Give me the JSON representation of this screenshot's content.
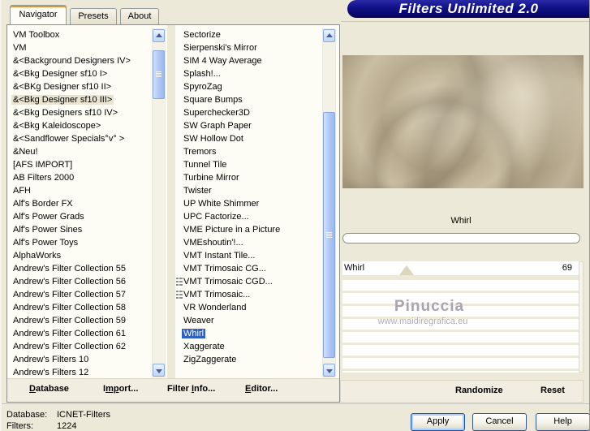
{
  "window": {
    "banner_title": "Filters Unlimited 2.0"
  },
  "tabs": {
    "navigator": "Navigator",
    "presets": "Presets",
    "about": "About"
  },
  "category_list": {
    "selected_index": 5,
    "items": [
      "VM Toolbox",
      "VM",
      "&<Background Designers IV>",
      "&<Bkg Designer sf10 I>",
      "&<BKg Designer sf10 II>",
      "&<Bkg Designer sf10 III>",
      "&<Bkg Designers sf10 IV>",
      "&<Bkg Kaleidoscope>",
      "&<Sandflower Specials°v° >",
      "&Neu!",
      "[AFS IMPORT]",
      "AB Filters 2000",
      "AFH",
      "Alf's Border FX",
      "Alf's Power Grads",
      "Alf's Power Sines",
      "Alf's Power Toys",
      "AlphaWorks",
      "Andrew's Filter Collection 55",
      "Andrew's Filter Collection 56",
      "Andrew's Filter Collection 57",
      "Andrew's Filter Collection 58",
      "Andrew's Filter Collection 59",
      "Andrew's Filter Collection 61",
      "Andrew's Filter Collection 62",
      "Andrew's Filters 10",
      "Andrew's Filters 12"
    ]
  },
  "filter_list": {
    "selected_index": 23,
    "icon_indices": [
      19,
      20
    ],
    "items": [
      "Sectorize",
      "Sierpenski's Mirror",
      "SIM 4 Way Average",
      "Splash!...",
      "SpyroZag",
      "Square Bumps",
      "Superchecker3D",
      "SW Graph Paper",
      "SW Hollow Dot",
      "Tremors",
      "Tunnel Tile",
      "Turbine Mirror",
      "Twister",
      "UP White Shimmer",
      "UPC Factorize...",
      "VME Picture in a Picture",
      "VMEshoutin'!...",
      "VMT Instant Tile...",
      "VMT Trimosaic CG...",
      "VMT Trimosaic CGD...",
      "VMT Trimosaic...",
      "VR Wonderland",
      "Weaver",
      "Whirl",
      "Xaggerate",
      "ZigZaggerate"
    ]
  },
  "preview": {
    "filter_name": "Whirl"
  },
  "slider": {
    "label": "Whirl",
    "value": "69"
  },
  "watermark": {
    "name": "Pinuccia",
    "url": "www.maidiregrafica.eu"
  },
  "actions": {
    "database": {
      "pre": "",
      "u": "D",
      "post": "atabase"
    },
    "import": {
      "pre": "I",
      "u": "mp",
      "post": "ort..."
    },
    "filter_info": {
      "pre": "Filter ",
      "u": "I",
      "post": "nfo..."
    },
    "editor": {
      "pre": "",
      "u": "E",
      "post": "ditor..."
    },
    "randomize": "Randomize",
    "reset": "Reset"
  },
  "dialog_buttons": {
    "apply": "Apply",
    "cancel": "Cancel",
    "help": "Help"
  },
  "status": {
    "database_label": "Database:",
    "database_value": "ICNET-Filters",
    "filters_label": "Filters:",
    "filters_value": "1224"
  },
  "colors": {
    "banner_navy": "#0b0b78",
    "selection_blue": "#2f5fc0",
    "selection_beige": "#e9e4cf",
    "dialog_bg": "#ece9d8"
  }
}
